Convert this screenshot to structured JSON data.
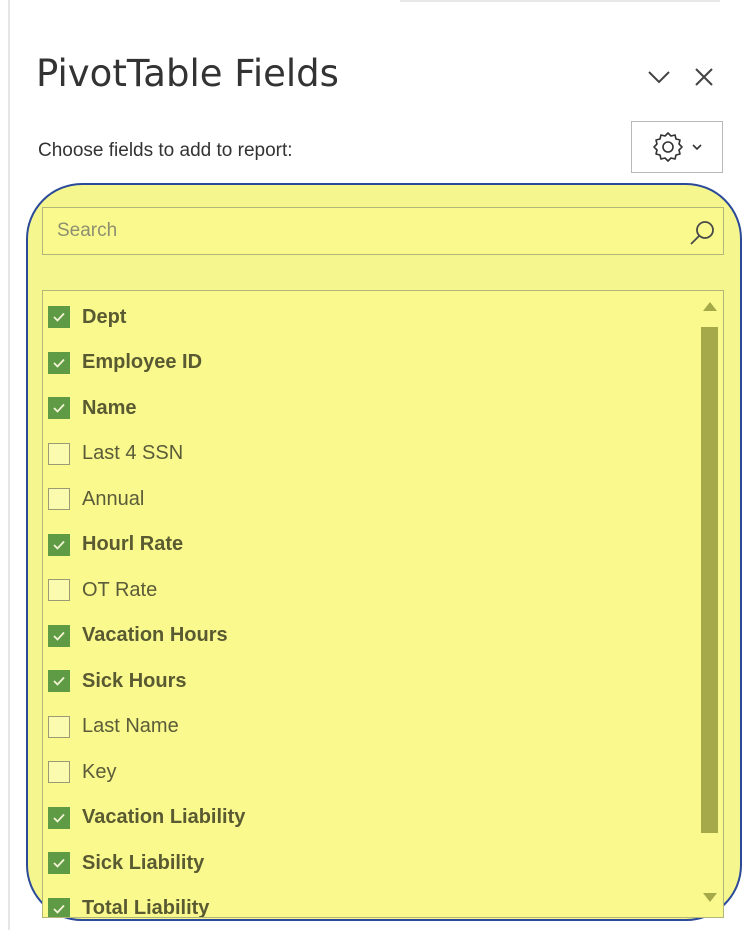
{
  "pane": {
    "title": "PivotTable Fields",
    "subtitle": "Choose fields to add to report:",
    "collapse_icon": "chevron-down-icon",
    "close_icon": "close-icon",
    "tools_icon": "gear-icon",
    "tools_dropdown_icon": "chevron-down-icon"
  },
  "search": {
    "placeholder": "Search",
    "value": "",
    "icon": "search-icon"
  },
  "fields": [
    {
      "label": "Dept",
      "checked": true
    },
    {
      "label": "Employee ID",
      "checked": true
    },
    {
      "label": "Name",
      "checked": true
    },
    {
      "label": "Last 4 SSN",
      "checked": false
    },
    {
      "label": "Annual",
      "checked": false
    },
    {
      "label": "Hourl Rate",
      "checked": true
    },
    {
      "label": "OT Rate",
      "checked": false
    },
    {
      "label": "Vacation Hours",
      "checked": true
    },
    {
      "label": "Sick Hours",
      "checked": true
    },
    {
      "label": "Last Name",
      "checked": false
    },
    {
      "label": "Key",
      "checked": false
    },
    {
      "label": "Vacation Liability",
      "checked": true
    },
    {
      "label": "Sick Liability",
      "checked": true
    },
    {
      "label": "Total Liability",
      "checked": true
    }
  ],
  "colors": {
    "highlight": "#f6f68f",
    "checkbox_checked": "#5f9a44",
    "scroll_thumb": "#a6a94a",
    "annotation_outline": "#2b4a9a"
  }
}
